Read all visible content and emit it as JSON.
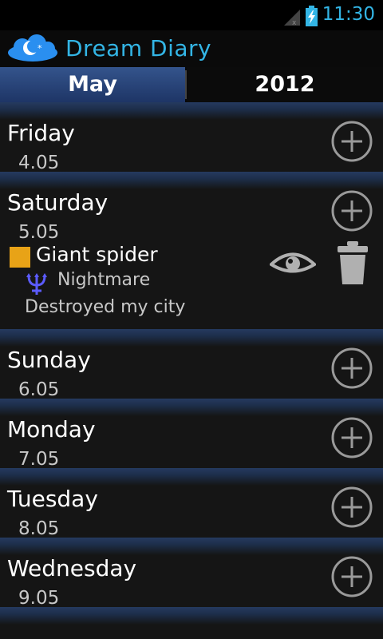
{
  "status_bar": {
    "time": "11:30"
  },
  "app": {
    "title": "Dream Diary"
  },
  "tabs": {
    "month": "May",
    "year": "2012"
  },
  "days": [
    {
      "name": "Friday",
      "date": "4.05"
    },
    {
      "name": "Saturday",
      "date": "5.05"
    },
    {
      "name": "Sunday",
      "date": "6.05"
    },
    {
      "name": "Monday",
      "date": "7.05"
    },
    {
      "name": "Tuesday",
      "date": "8.05"
    },
    {
      "name": "Wednesday",
      "date": "9.05"
    }
  ],
  "dream": {
    "title": "Giant spider",
    "category": "Nightmare",
    "description": "Destroyed my city",
    "color": "#e8a317",
    "category_icon": "trident-icon"
  },
  "colors": {
    "accent": "#33b5e5",
    "category_icon": "#5b5bff"
  }
}
